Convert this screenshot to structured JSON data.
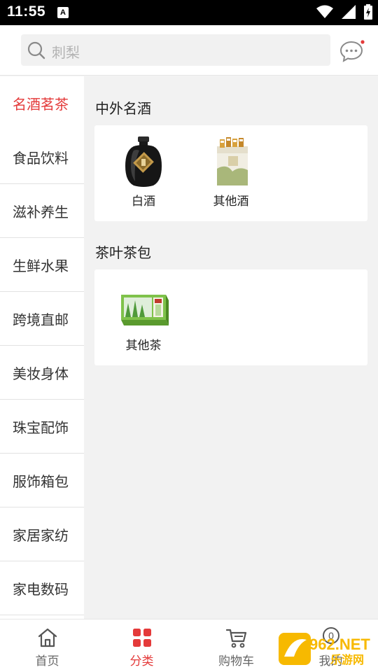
{
  "status_bar": {
    "time": "11:55",
    "notification_icon": "A"
  },
  "header": {
    "search_placeholder": "刺梨",
    "message_icon": "chat-bubble-icon",
    "accent_color": "#e43a3a"
  },
  "sidebar": {
    "items": [
      {
        "label": "名酒茗茶",
        "active": true
      },
      {
        "label": "食品饮料"
      },
      {
        "label": "滋补养生"
      },
      {
        "label": "生鲜水果"
      },
      {
        "label": "跨境直邮"
      },
      {
        "label": "美妆身体"
      },
      {
        "label": "珠宝配饰"
      },
      {
        "label": "服饰箱包"
      },
      {
        "label": "家居家纺"
      },
      {
        "label": "家电数码"
      }
    ]
  },
  "main": {
    "sections": [
      {
        "title": "中外名酒",
        "products": [
          {
            "label": "白酒"
          },
          {
            "label": "其他酒"
          }
        ]
      },
      {
        "title": "茶叶茶包",
        "products": [
          {
            "label": "其他茶"
          }
        ]
      }
    ]
  },
  "bottom_nav": {
    "items": [
      {
        "label": "首页",
        "icon": "home-icon"
      },
      {
        "label": "分类",
        "icon": "category-icon",
        "active": true
      },
      {
        "label": "购物车",
        "icon": "cart-icon"
      },
      {
        "label": "我的",
        "icon": "user-icon",
        "badge": "0"
      }
    ]
  },
  "watermark": {
    "text": "962.NET",
    "subtext": "乐游网"
  }
}
